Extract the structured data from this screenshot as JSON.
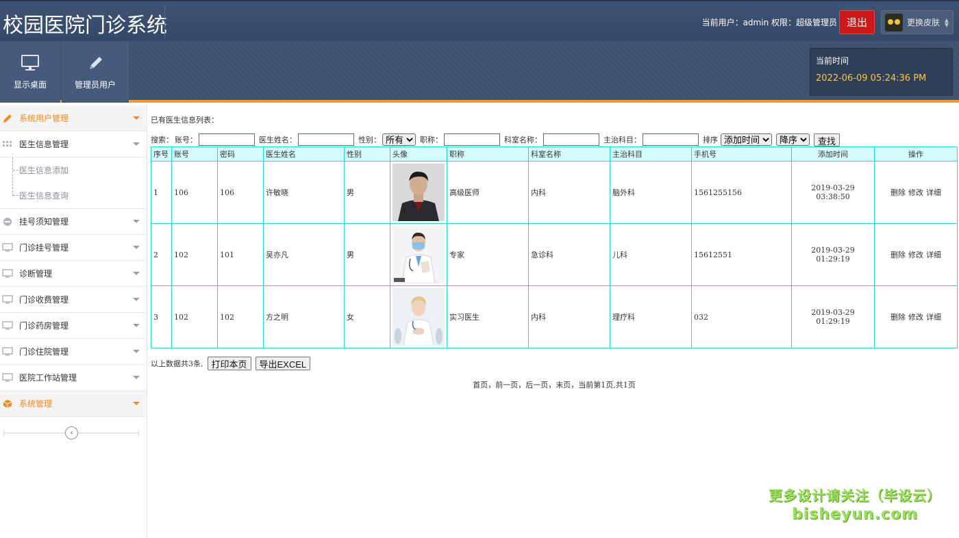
{
  "header": {
    "title": "校园医院门诊系统",
    "user_info": "当前用户：admin  权限：超级管理员",
    "logout_label": "退出",
    "skin_label": "更换皮肤"
  },
  "toolbar": {
    "desktop_label": "显示桌面",
    "admin_label": "管理员用户",
    "time_label": "当前时间",
    "time_value": "2022-06-09 05:24:36 PM"
  },
  "sidebar": {
    "items": [
      {
        "label": "系统用户管理",
        "icon": "pencil-icon"
      },
      {
        "label": "医生信息管理",
        "icon": "grid-icon"
      },
      {
        "label": "挂号须知管理",
        "icon": "minus-circle-icon"
      },
      {
        "label": "门诊挂号管理",
        "icon": "monitor-icon"
      },
      {
        "label": "诊断管理",
        "icon": "monitor-icon"
      },
      {
        "label": "门诊收费管理",
        "icon": "monitor-icon"
      },
      {
        "label": "门诊药房管理",
        "icon": "monitor-icon"
      },
      {
        "label": "门诊住院管理",
        "icon": "monitor-icon"
      },
      {
        "label": "医院工作站管理",
        "icon": "monitor-icon"
      },
      {
        "label": "系统管理",
        "icon": "box-icon"
      }
    ],
    "subitems": [
      "医生信息添加",
      "医生信息查询"
    ]
  },
  "main": {
    "list_title": "已有医生信息列表：",
    "search": {
      "prefix": "搜索：",
      "account_label": "账号：",
      "name_label": "医生姓名：",
      "gender_label": "性别：",
      "gender_value": "所有",
      "title_label": "职称：",
      "dept_label": "科室名称：",
      "subject_label": "主治科目：",
      "sort_label": "排序",
      "sort_value": "添加时间",
      "order_value": "降序",
      "search_button": "查找"
    },
    "columns": [
      "序号",
      "账号",
      "密码",
      "医生姓名",
      "性别",
      "头像",
      "职称",
      "科室名称",
      "主治科目",
      "手机号",
      "添加时间",
      "操作"
    ],
    "rows": [
      {
        "no": "1",
        "account": "106",
        "password": "106",
        "name": "许敏晓",
        "gender": "男",
        "title": "高级医师",
        "dept": "内科",
        "subject": "脑外科",
        "phone": "1561255156",
        "added": "2019-03-29 03:38:50"
      },
      {
        "no": "2",
        "account": "102",
        "password": "101",
        "name": "吴亦凡",
        "gender": "男",
        "title": "专家",
        "dept": "急诊科",
        "subject": "儿科",
        "phone": "15612551",
        "added": "2019-03-29 01:29:19"
      },
      {
        "no": "3",
        "account": "102",
        "password": "102",
        "name": "方之明",
        "gender": "女",
        "title": "实习医生",
        "dept": "内科",
        "subject": "理疗科",
        "phone": "032",
        "added": "2019-03-29 01:29:19"
      }
    ],
    "ops": {
      "delete": "删除",
      "edit": "修改",
      "detail": "详细"
    },
    "summary": "以上数据共3条,",
    "print_button": "打印本页",
    "export_button": "导出EXCEL",
    "pager": "首页，前一页，后一页，末页，当前第1页,共1页"
  },
  "watermark": {
    "line1": "更多设计请关注（毕设云）",
    "line2": "bisheyun.com"
  },
  "colors": {
    "header_bg": "#3d5170",
    "accent_orange": "#f29b33",
    "logout_red": "#cc1a1a",
    "table_border": "#29d4e0",
    "table_head_bg": "#d6fbfc",
    "time_yellow": "#f5c94a"
  }
}
